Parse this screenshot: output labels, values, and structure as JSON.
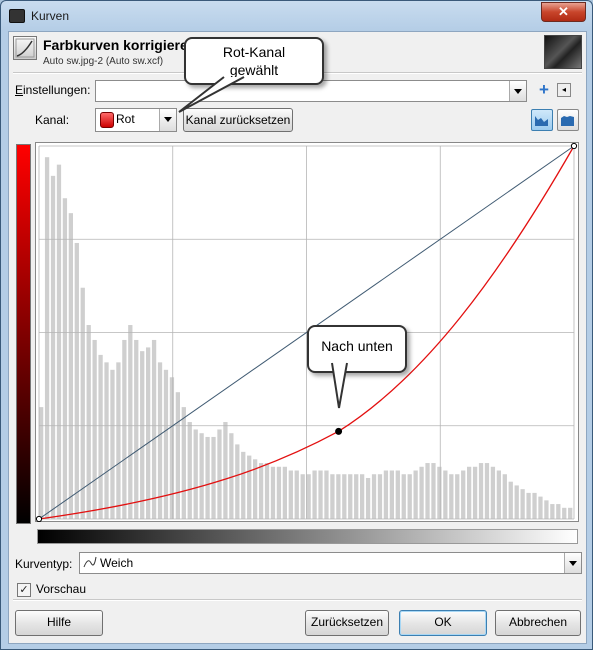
{
  "window": {
    "title": "Kurven",
    "close_glyph": "✕"
  },
  "header": {
    "title": "Farbkurven korrigiere",
    "subtitle": "Auto sw.jpg-2 (Auto sw.xcf)"
  },
  "settings": {
    "label": "Einstellungen:",
    "value": "",
    "add_icon": "plus-icon",
    "menu_icon": "arrow-left-icon"
  },
  "channel": {
    "label": "Kanal:",
    "value": "Rot",
    "reset_label": "Kanal zurücksetzen"
  },
  "callouts": {
    "channel": "Rot-Kanal\ngewählt",
    "curve": "Nach unten"
  },
  "curve_type": {
    "label": "Kurventyp:",
    "value": "Weich"
  },
  "preview": {
    "label": "Vorschau",
    "checked": true
  },
  "buttons": {
    "help": "Hilfe",
    "reset": "Zurücksetzen",
    "ok": "OK",
    "cancel": "Abbrechen"
  },
  "colors": {
    "curve": "#e31010",
    "diagonal": "#3f5a72",
    "histogram": "#cfcfcf",
    "grid": "#b5b5b5"
  },
  "curve": {
    "points": [
      [
        0,
        0
      ],
      [
        0.56,
        0.235
      ],
      [
        1,
        1
      ]
    ],
    "type": "smooth"
  },
  "histogram": {
    "values": [
      0.3,
      0.97,
      0.92,
      0.95,
      0.86,
      0.82,
      0.74,
      0.62,
      0.52,
      0.48,
      0.44,
      0.42,
      0.4,
      0.42,
      0.48,
      0.52,
      0.48,
      0.45,
      0.46,
      0.48,
      0.42,
      0.4,
      0.38,
      0.34,
      0.3,
      0.26,
      0.24,
      0.23,
      0.22,
      0.22,
      0.24,
      0.26,
      0.23,
      0.2,
      0.18,
      0.17,
      0.16,
      0.15,
      0.15,
      0.14,
      0.14,
      0.14,
      0.13,
      0.13,
      0.12,
      0.12,
      0.13,
      0.13,
      0.13,
      0.12,
      0.12,
      0.12,
      0.12,
      0.12,
      0.12,
      0.11,
      0.12,
      0.12,
      0.13,
      0.13,
      0.13,
      0.12,
      0.12,
      0.13,
      0.14,
      0.15,
      0.15,
      0.14,
      0.13,
      0.12,
      0.12,
      0.13,
      0.14,
      0.14,
      0.15,
      0.15,
      0.14,
      0.13,
      0.12,
      0.1,
      0.09,
      0.08,
      0.07,
      0.07,
      0.06,
      0.05,
      0.04,
      0.04,
      0.03,
      0.03
    ]
  }
}
